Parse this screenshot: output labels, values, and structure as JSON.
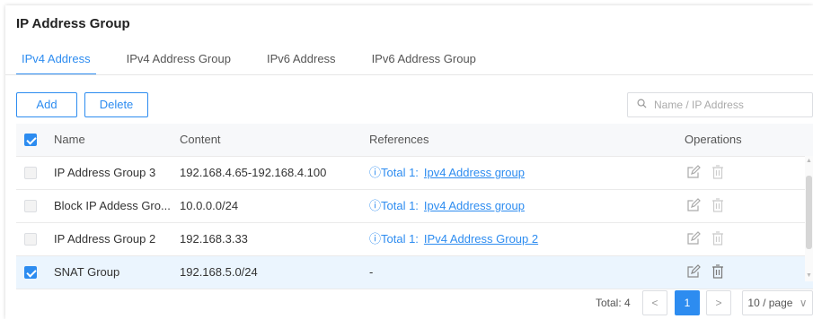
{
  "title": "IP Address Group",
  "tabs": [
    {
      "label": "IPv4 Address",
      "active": true
    },
    {
      "label": "IPv4 Address Group",
      "active": false
    },
    {
      "label": "IPv6 Address",
      "active": false
    },
    {
      "label": "IPv6 Address Group",
      "active": false
    }
  ],
  "toolbar": {
    "add_label": "Add",
    "delete_label": "Delete"
  },
  "search": {
    "placeholder": "Name / IP Address",
    "icon": "search-icon"
  },
  "table": {
    "columns": {
      "name": "Name",
      "content": "Content",
      "references": "References",
      "operations": "Operations"
    },
    "header_checked": true,
    "rows": [
      {
        "name": "IP Address Group 3",
        "content": "192.168.4.65-192.168.4.100",
        "ref_prefix": "ⓘTotal 1:",
        "ref_link": "Ipv4 Address group",
        "checked": false,
        "selected": false
      },
      {
        "name": "Block IP Addess Gro...",
        "content": "10.0.0.0/24",
        "ref_prefix": "ⓘTotal 1:",
        "ref_link": "Ipv4 Address group",
        "checked": false,
        "selected": false
      },
      {
        "name": "IP Address Group 2",
        "content": "192.168.3.33",
        "ref_prefix": "ⓘTotal 1:",
        "ref_link": "IPv4 Address Group 2",
        "checked": false,
        "selected": false
      },
      {
        "name": "SNAT Group",
        "content": "192.168.5.0/24",
        "ref_prefix": "-",
        "ref_link": "",
        "checked": true,
        "selected": true
      }
    ]
  },
  "pagination": {
    "total_label": "Total: 4",
    "current_page": "1",
    "prev": "<",
    "next": ">",
    "page_size": "10 / page"
  },
  "colors": {
    "accent": "#2d8cf0",
    "header_bg": "#f7f8fa",
    "selected_row_bg": "#ebf5fe"
  }
}
